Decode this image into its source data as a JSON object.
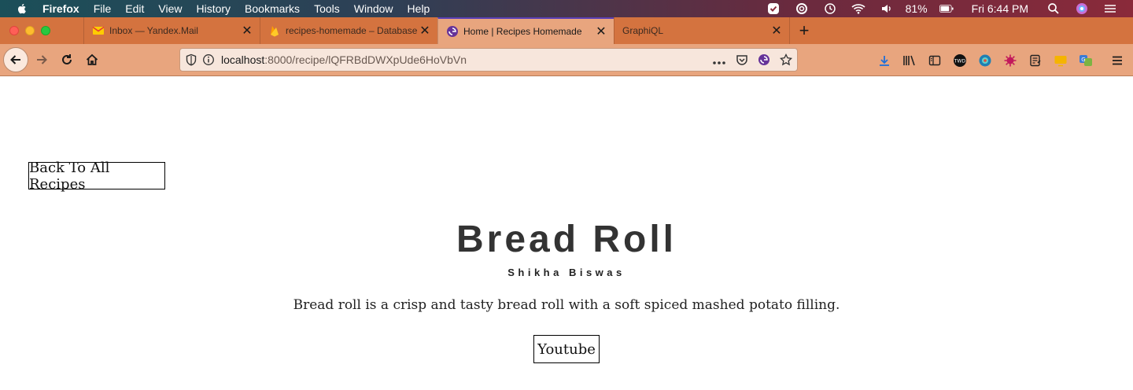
{
  "menubar": {
    "app_name": "Firefox",
    "items": [
      "File",
      "Edit",
      "View",
      "History",
      "Bookmarks",
      "Tools",
      "Window",
      "Help"
    ],
    "battery": "81%",
    "clock": "Fri 6:44 PM"
  },
  "tabs": [
    {
      "label": "Inbox — Yandex.Mail",
      "icon": "mail-icon",
      "active": false
    },
    {
      "label": "recipes-homemade – Database",
      "icon": "firebase-icon",
      "active": false
    },
    {
      "label": "Home | Recipes Homemade",
      "icon": "gatsby-icon",
      "active": true
    },
    {
      "label": "GraphiQL",
      "icon": "",
      "active": false
    }
  ],
  "navbar": {
    "url_host": "localhost",
    "url_rest": ":8000/recipe/lQFRBdDWXpUde6HoVbVn"
  },
  "page": {
    "back_label": "Back To All Recipes",
    "title": "Bread Roll",
    "author": "Shikha Biswas",
    "description": "Bread roll is a crisp and tasty bread roll with a soft spiced mashed potato filling.",
    "youtube_label": "Youtube"
  },
  "colors": {
    "tabstrip": "#d4733f",
    "toolbar": "#e8a57e",
    "active_tab_accent": "#5b3fb5"
  }
}
